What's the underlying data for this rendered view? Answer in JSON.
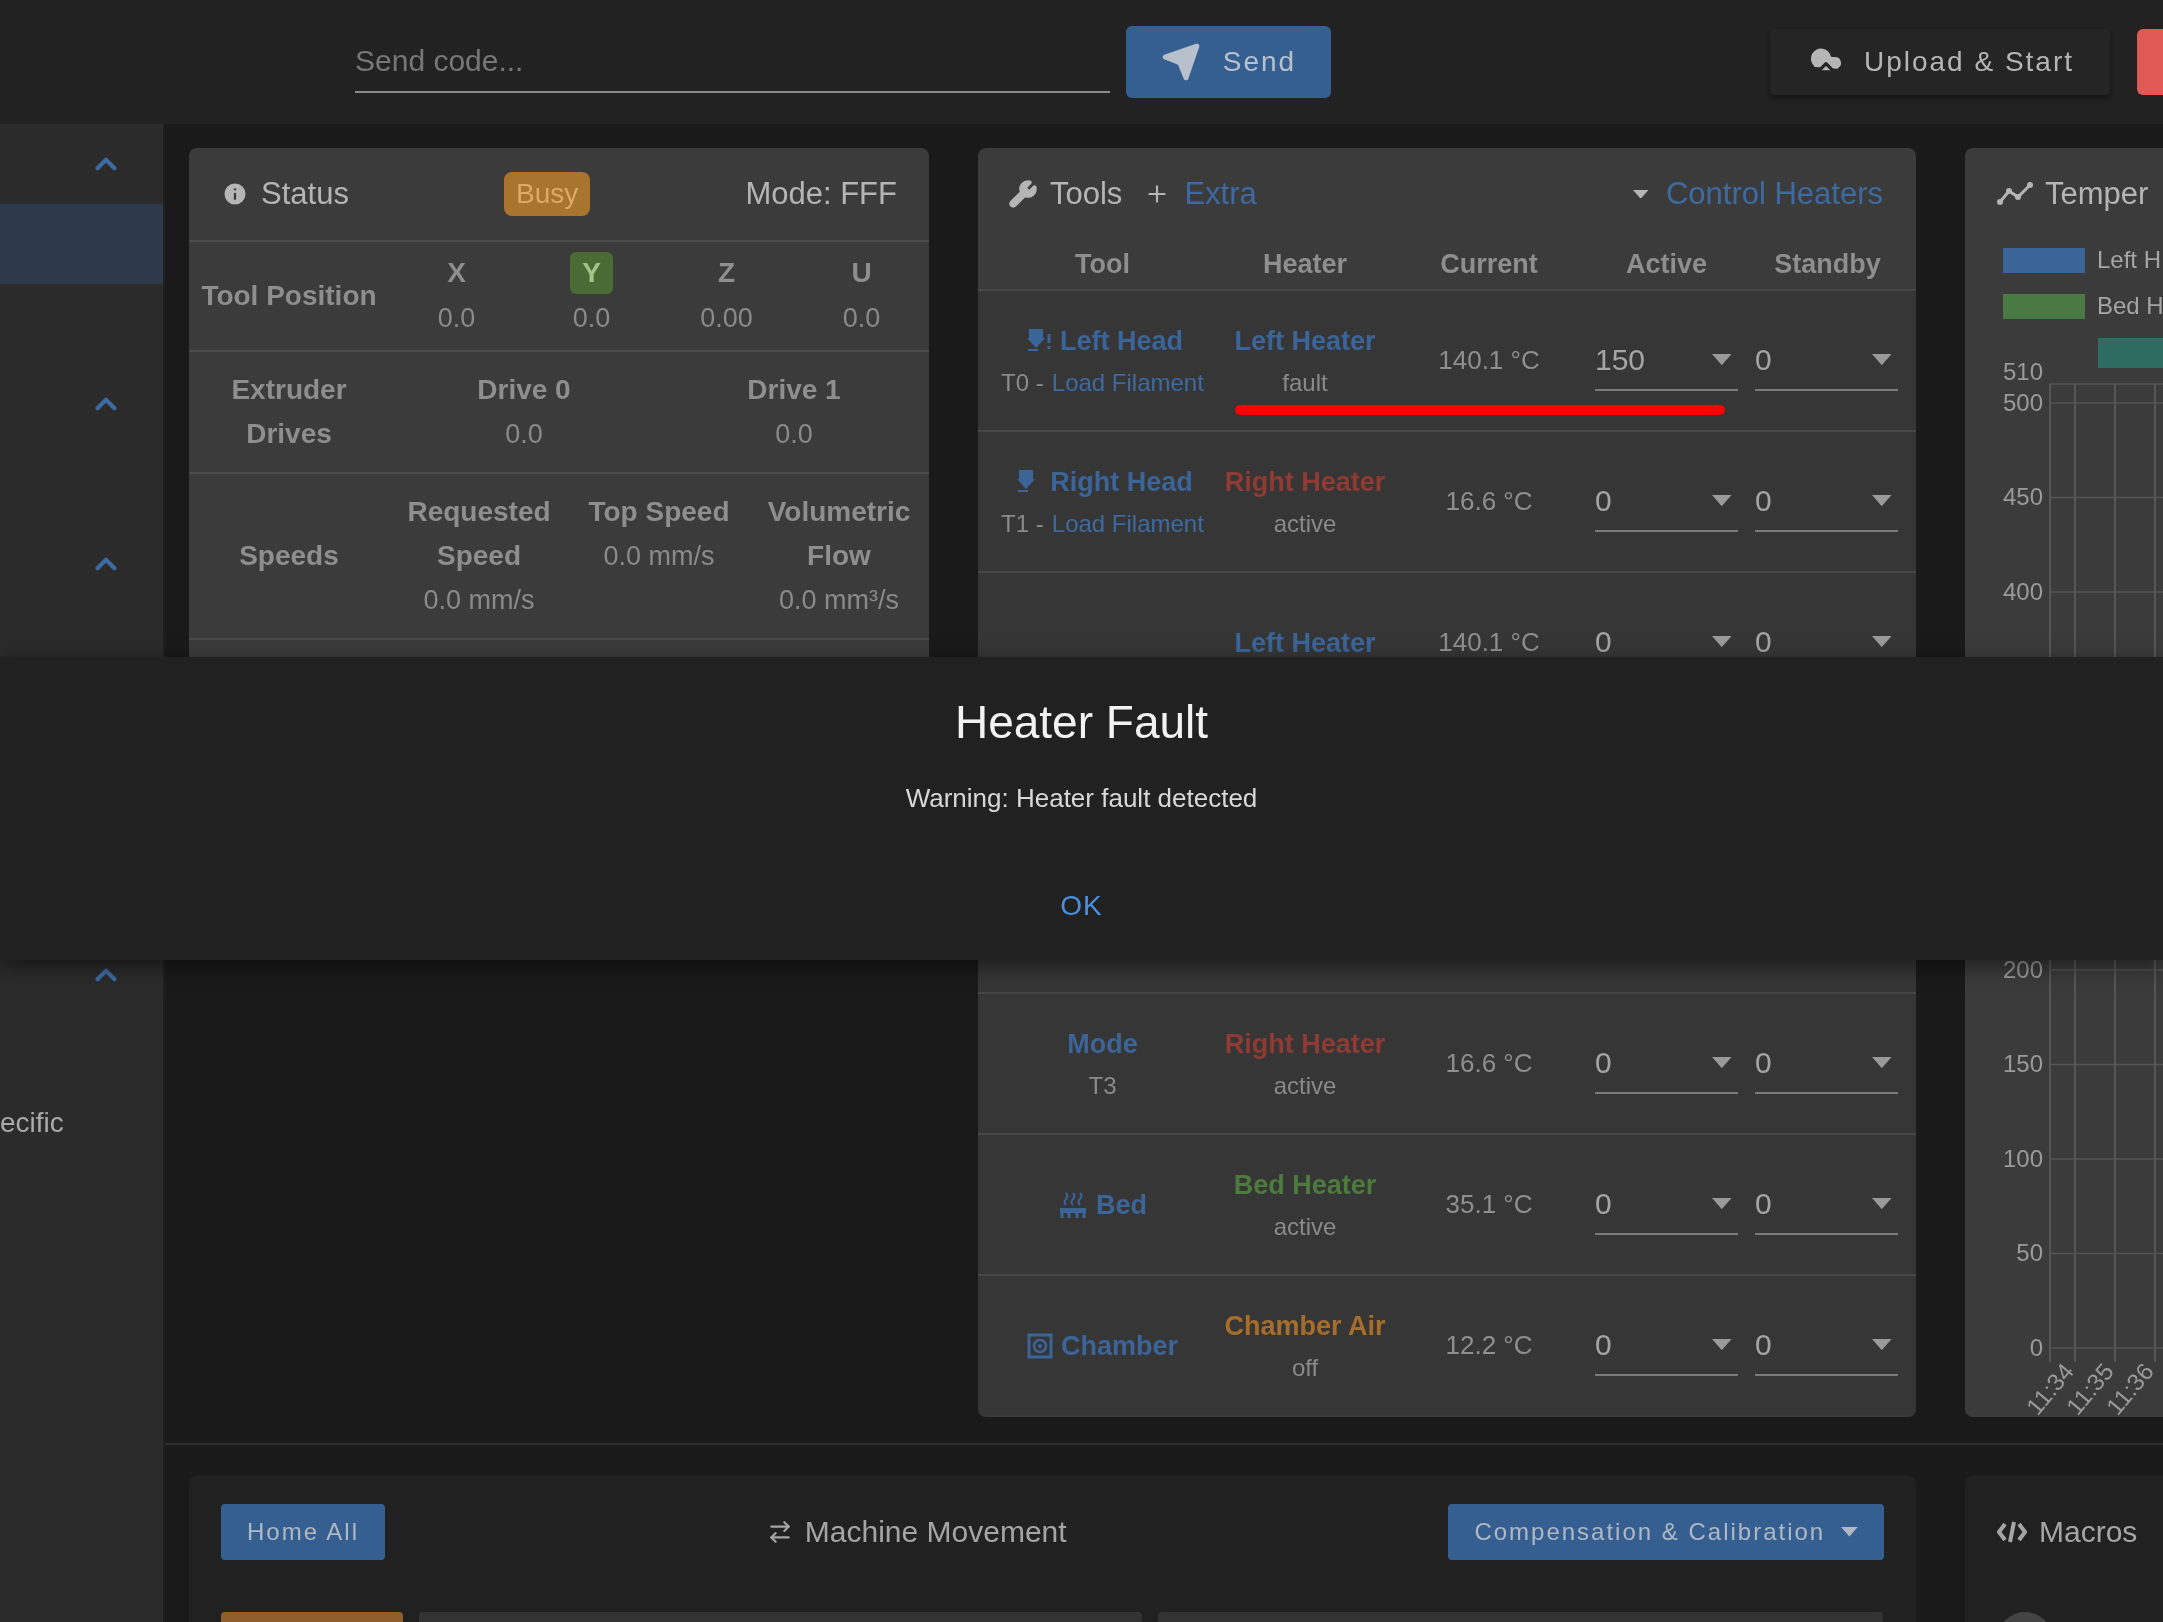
{
  "top_bar": {
    "command_placeholder": "Send code...",
    "send_label": "Send",
    "upload_label": "Upload & Start"
  },
  "sidebar": {
    "items": [
      {
        "kind": "section",
        "expanded": true
      },
      {
        "kind": "item",
        "selected": true
      },
      {
        "kind": "section",
        "expanded": true
      },
      {
        "kind": "section",
        "expanded": true
      },
      {
        "kind": "section",
        "expanded": true
      },
      {
        "kind": "item",
        "label": "ecific",
        "selected": false
      }
    ]
  },
  "status": {
    "title": "Status",
    "badge": "Busy",
    "mode": "Mode: FFF",
    "tool_position": {
      "label": "Tool Position",
      "axes": [
        {
          "name": "X",
          "value": "0.0",
          "homed": false
        },
        {
          "name": "Y",
          "value": "0.0",
          "homed": true
        },
        {
          "name": "Z",
          "value": "0.00",
          "homed": false
        },
        {
          "name": "U",
          "value": "0.0",
          "homed": false
        }
      ]
    },
    "extruder_drives": {
      "label": "Extruder Drives",
      "drives": [
        {
          "name": "Drive 0",
          "value": "0.0"
        },
        {
          "name": "Drive 1",
          "value": "0.0"
        }
      ]
    },
    "speeds": {
      "label": "Speeds",
      "items": [
        {
          "name": "Requested Speed",
          "value": "0.0 mm/s"
        },
        {
          "name": "Top Speed",
          "value": "0.0 mm/s"
        },
        {
          "name": "Volumetric Flow",
          "value": "0.0 mm³/s"
        }
      ]
    }
  },
  "tools": {
    "title": "Tools",
    "extra": "Extra",
    "control_heaters": "Control Heaters",
    "columns": [
      "Tool",
      "Heater",
      "Current",
      "Active",
      "Standby"
    ],
    "rows": [
      {
        "kind": "head-alert",
        "tool": "Left Head",
        "number": "T0 -",
        "link": "Load Filament",
        "heater": "Left Heater",
        "color": "#3b6499",
        "heater_status": "fault",
        "current": "140.1 °C",
        "active": "150",
        "standby": "0",
        "highlighted": true
      },
      {
        "kind": "head",
        "tool": "Right Head",
        "number": "T1 -",
        "link": "Load Filament",
        "heater": "Right Heater",
        "color": "#8f3b33",
        "heater_status": "active",
        "current": "16.6 °C",
        "active": "0",
        "standby": "0",
        "highlighted": false
      },
      {
        "heater": "Left Heater",
        "color": "#3b6499",
        "current": "140.1 °C",
        "active": "0",
        "standby": "0",
        "highlighted": false
      },
      {
        "tool": "Mode",
        "subtitle": "T3",
        "heater": "Right Heater",
        "color": "#8f3b33",
        "heater_status": "active",
        "current": "16.6 °C",
        "active": "0",
        "standby": "0",
        "highlighted": false
      },
      {
        "kind": "bed",
        "tool": "Bed",
        "heater": "Bed Heater",
        "color": "#4d7a3d",
        "heater_status": "active",
        "current": "35.1 °C",
        "active": "0",
        "standby": "0",
        "highlighted": false
      },
      {
        "kind": "chamber",
        "tool": "Chamber",
        "heater": "Chamber Air",
        "color": "#a66d2b",
        "heater_status": "off",
        "current": "12.2 °C",
        "active": "0",
        "standby": "0",
        "highlighted": false
      }
    ]
  },
  "temperature": {
    "title": "Temper",
    "chart_data": {
      "type": "line",
      "categories": [
        "11:34",
        "11:35",
        "11:36"
      ],
      "ylim": [
        0,
        510
      ],
      "grid": true,
      "yticks": [
        0,
        50,
        100,
        150,
        200,
        400,
        450,
        500,
        510
      ],
      "series": [
        {
          "name": "Left H",
          "color": "#3b6499",
          "values": [
            null,
            null,
            null
          ]
        },
        {
          "name": "Bed H",
          "color": "#4a7a44",
          "values": [
            null,
            null,
            null
          ]
        },
        {
          "color": "#2e6b60",
          "values": [
            null,
            null,
            null
          ]
        }
      ]
    }
  },
  "movement": {
    "home_label": "Home All",
    "title": "Machine Movement",
    "calibration_label": "Compensation & Calibration"
  },
  "macros": {
    "title": "Macros"
  },
  "dialog": {
    "title": "Heater Fault",
    "message": "Warning: Heater fault detected",
    "button": "OK"
  }
}
